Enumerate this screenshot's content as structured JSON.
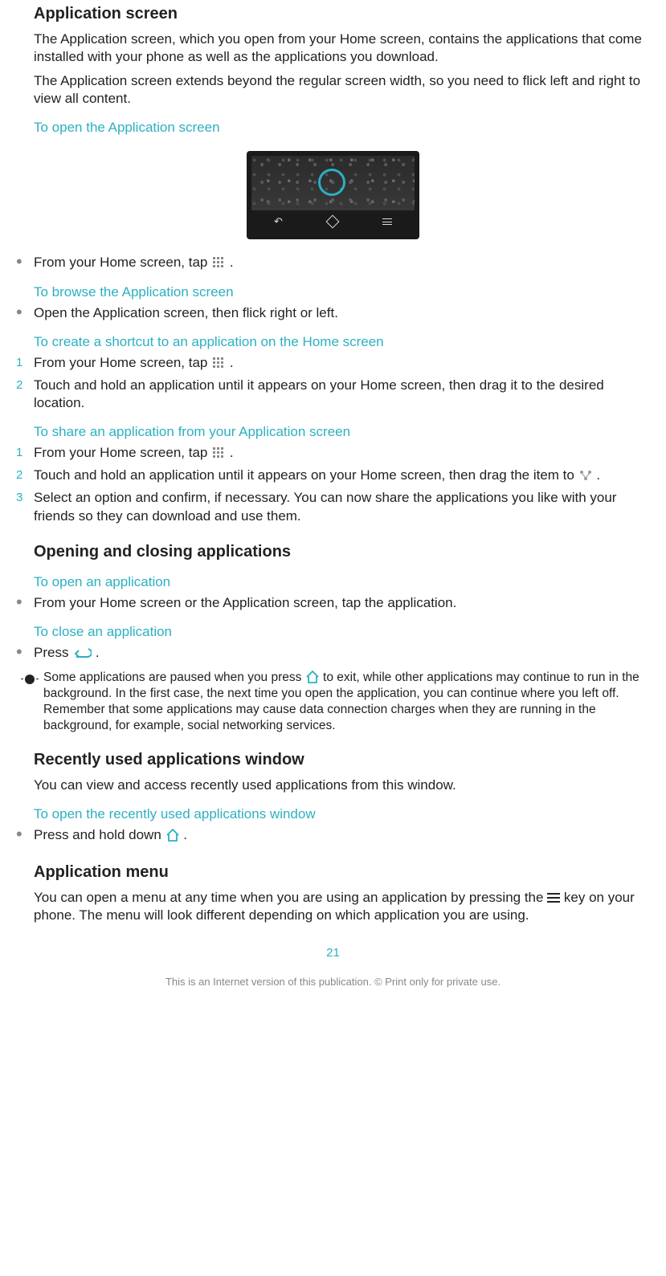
{
  "headings": {
    "app_screen": "Application screen",
    "open_close": "Opening and closing applications",
    "recent": "Recently used applications window",
    "app_menu": "Application menu"
  },
  "paragraphs": {
    "app_screen_1": "The Application screen, which you open from your Home screen, contains the applications that come installed with your phone as well as the applications you download.",
    "app_screen_2": "The Application screen extends beyond the regular screen width, so you need to flick left and right to view all content.",
    "recent_1": "You can view and access recently used applications from this window.",
    "app_menu_1a": "You can open a menu at any time when you are using an application by pressing the ",
    "app_menu_1b": " key on your phone. The menu will look different depending on which application you are using."
  },
  "subheads": {
    "open_app_screen": "To open the Application screen",
    "browse_app_screen": "To browse the Application screen",
    "create_shortcut": "To create a shortcut to an application on the Home screen",
    "share_app": "To share an application from your Application screen",
    "open_app": "To open an application",
    "close_app": "To close an application",
    "open_recent": "To open the recently used applications window"
  },
  "steps": {
    "open_app_screen_bullet_a": "From your Home screen, tap ",
    "open_app_screen_bullet_b": ".",
    "browse_bullet": "Open the Application screen, then flick right or left.",
    "shortcut_1a": "From your Home screen, tap ",
    "shortcut_1b": " .",
    "shortcut_2": "Touch and hold an application until it appears on your Home screen, then drag it to the desired location.",
    "share_1a": "From your Home screen, tap ",
    "share_1b": ".",
    "share_2a": "Touch and hold an application until it appears on your Home screen, then drag the item to ",
    "share_2b": ".",
    "share_3": "Select an option and confirm, if necessary. You can now share the applications you like with your friends so they can download and use them.",
    "open_app_bullet": "From your Home screen or the Application screen, tap the application.",
    "close_app_bullet_a": "Press ",
    "close_app_bullet_b": ".",
    "recent_bullet_a": "Press and hold down ",
    "recent_bullet_b": "."
  },
  "tip": {
    "a": "Some applications are paused when you press ",
    "b": " to exit, while other applications may continue to run in the background. In the first case, the next time you open the application, you can continue where you left off. Remember that some applications may cause data connection charges when they are running in the background, for example, social networking services."
  },
  "markers": {
    "n1": "1",
    "n2": "2",
    "n3": "3"
  },
  "page_number": "21",
  "footer": "This is an Internet version of this publication. © Print only for private use."
}
